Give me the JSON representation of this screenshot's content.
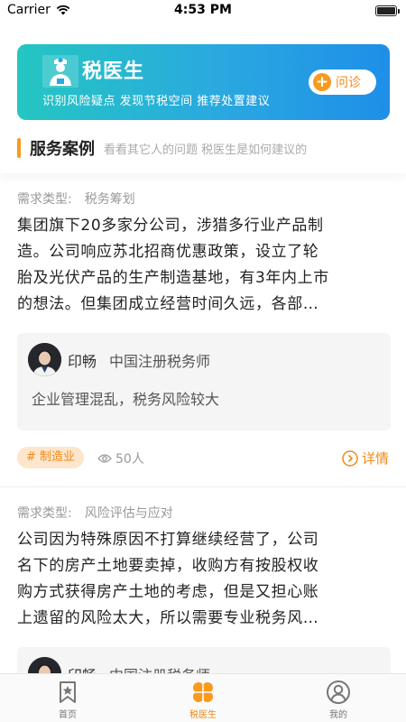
{
  "status_bar": {
    "carrier": "Carrier",
    "time": "4:53 PM"
  },
  "banner": {
    "title": "税医生",
    "subtitle": "识别风险疑点 发现节税空间 推荐处置建议",
    "consult_label": "问诊"
  },
  "section": {
    "title": "服务案例",
    "subtitle": "看看其它人的问题 税医生是如何建议的"
  },
  "cases": [
    {
      "type_label": "需求类型:",
      "type_value": "税务筹划",
      "lines": [
        "集团旗下20多家分公司，涉猎多行业产品制",
        "造。公司响应苏北招商优惠政策，设立了轮",
        "胎及光伏产品的生产制造基地，有3年内上市",
        "的想法。但集团成立经营时间久远，各部…"
      ],
      "expert_name": "印畅",
      "expert_title": "中国注册税务师",
      "expert_advice": "企业管理混乱，税务风险较大",
      "tag": "# 制造业",
      "views": "50人",
      "detail_label": "详情"
    },
    {
      "type_label": "需求类型:",
      "type_value": "风险评估与应对",
      "lines": [
        "公司因为特殊原因不打算继续经营了，公司",
        "名下的房产土地要卖掉，收购方有按股权收",
        "购方式获得房产土地的考虑，但是又担心账",
        "上遗留的风险太大，所以需要专业税务风…"
      ],
      "expert_name": "印畅",
      "expert_title": "中国注册税务师"
    }
  ],
  "tabs": [
    {
      "label": "首页",
      "icon": "bookmark-star-icon"
    },
    {
      "label": "税医生",
      "icon": "clover-icon",
      "active": true
    },
    {
      "label": "我的",
      "icon": "user-circle-icon"
    }
  ],
  "colors": {
    "accent": "#F99A1E",
    "banner_start": "#25C6C2",
    "banner_end": "#1E8FE8"
  }
}
